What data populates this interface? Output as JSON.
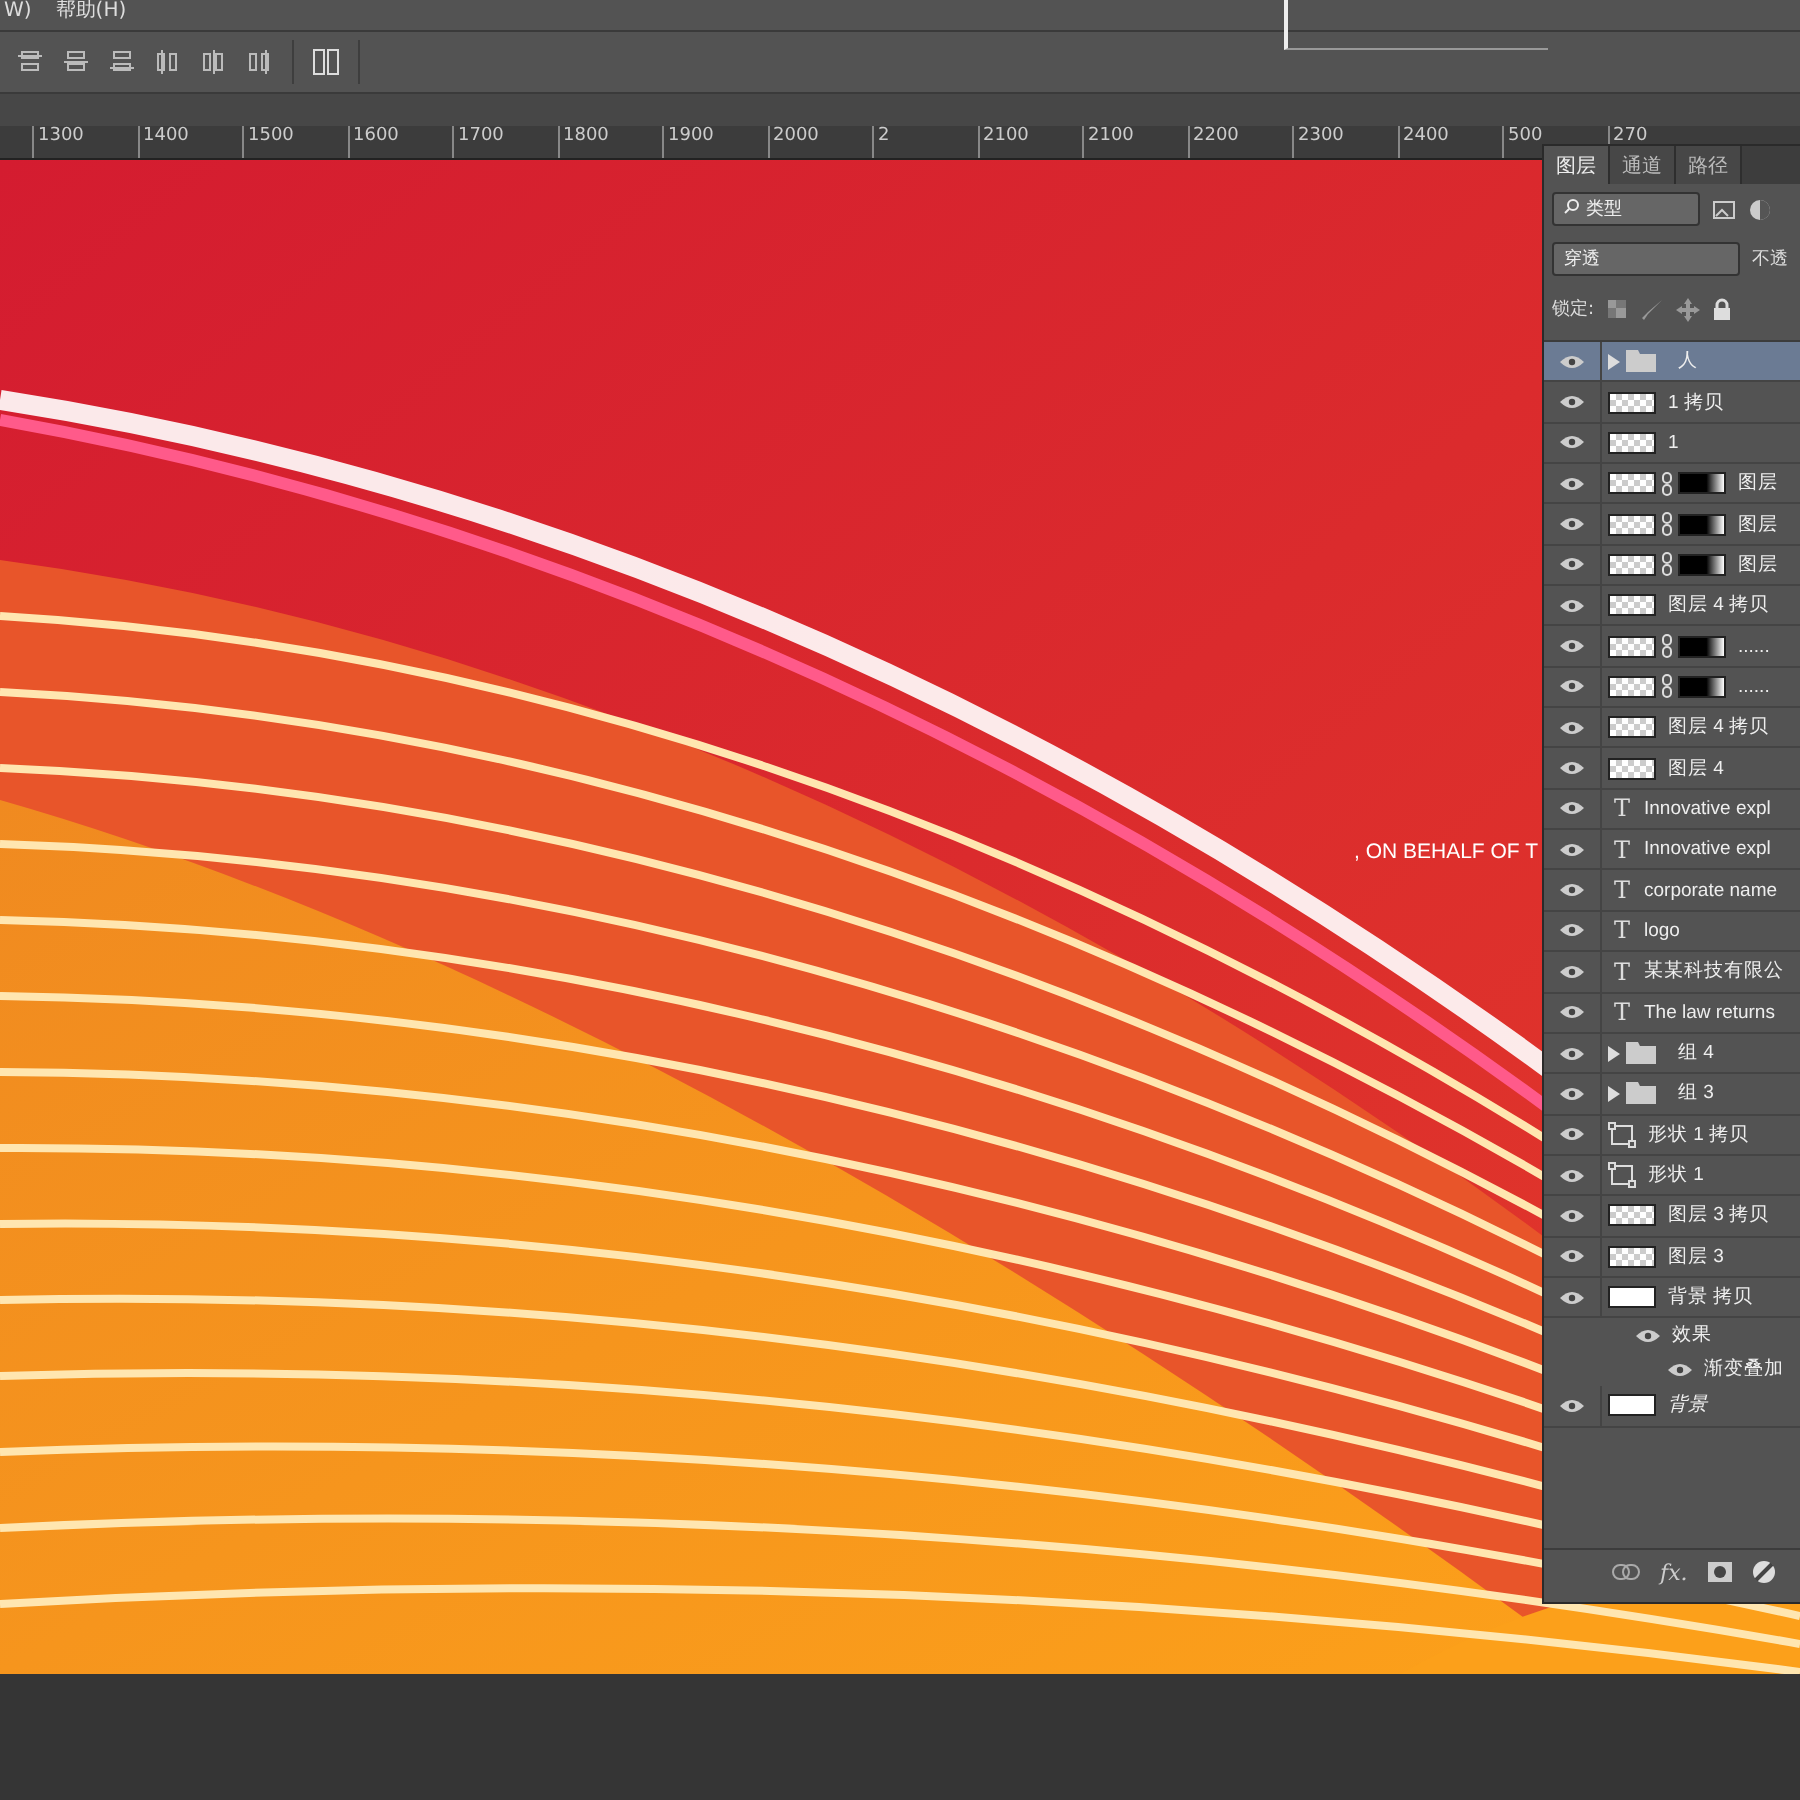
{
  "menu_bar": {
    "items": [
      "W)",
      "帮助(H)"
    ]
  },
  "ruler": {
    "labels": [
      "1300",
      "1400",
      "1500",
      "1600",
      "1700",
      "1800",
      "1900",
      "2000",
      "2",
      "2100",
      "2100",
      "2200",
      "2300",
      "2400",
      "500",
      "270"
    ]
  },
  "canvas": {
    "caption": ", ON BEHALF OF T"
  },
  "layers_panel": {
    "tabs": [
      {
        "label": "图层",
        "selected": true
      },
      {
        "label": "通道",
        "selected": false
      },
      {
        "label": "路径",
        "selected": false
      }
    ],
    "filter": "类型",
    "blend_mode": "穿透",
    "opacity_label": "不透",
    "lock_label": "锁定:",
    "layers": [
      {
        "kind": "group",
        "name": "人",
        "visible": true,
        "selected": true
      },
      {
        "kind": "pixel",
        "name": "1 拷贝",
        "visible": true,
        "selected": false
      },
      {
        "kind": "pixel",
        "name": "1",
        "visible": true,
        "selected": false
      },
      {
        "kind": "masked",
        "name": "图层",
        "visible": true,
        "selected": false
      },
      {
        "kind": "masked",
        "name": "图层",
        "visible": true,
        "selected": false
      },
      {
        "kind": "masked",
        "name": "图层",
        "visible": true,
        "selected": false
      },
      {
        "kind": "pixel",
        "name": "图层 4 拷贝",
        "visible": true,
        "selected": false
      },
      {
        "kind": "masked",
        "name": "......",
        "visible": true,
        "selected": false
      },
      {
        "kind": "masked",
        "name": "......",
        "visible": true,
        "selected": false
      },
      {
        "kind": "pixel",
        "name": "图层 4 拷贝",
        "visible": true,
        "selected": false
      },
      {
        "kind": "pixel",
        "name": "图层 4",
        "visible": true,
        "selected": false
      },
      {
        "kind": "text",
        "icon": "T",
        "name": "Innovative expl",
        "visible": true,
        "selected": false
      },
      {
        "kind": "text",
        "icon": "T",
        "name": "Innovative expl",
        "visible": true,
        "selected": false
      },
      {
        "kind": "text",
        "icon": "T",
        "name": "corporate name",
        "visible": true,
        "selected": false
      },
      {
        "kind": "text",
        "icon": "T",
        "name": "logo",
        "visible": true,
        "selected": false
      },
      {
        "kind": "text",
        "icon": "T",
        "name": "某某科技有限公",
        "visible": true,
        "selected": false
      },
      {
        "kind": "text",
        "icon": "T",
        "name": "The law returns",
        "visible": true,
        "selected": false
      },
      {
        "kind": "group",
        "name": "组 4",
        "visible": true,
        "selected": false
      },
      {
        "kind": "group",
        "name": "组 3",
        "visible": true,
        "selected": false
      },
      {
        "kind": "shape",
        "name": "形状 1 拷贝",
        "visible": true,
        "selected": false
      },
      {
        "kind": "shape",
        "name": "形状 1",
        "visible": true,
        "selected": false
      },
      {
        "kind": "pixel",
        "name": "图层 3 拷贝",
        "visible": true,
        "selected": false
      },
      {
        "kind": "pixel",
        "name": "图层 3",
        "visible": true,
        "selected": false
      },
      {
        "kind": "fill",
        "name": "背景 拷贝",
        "visible": true,
        "selected": false,
        "effects": {
          "label": "效果",
          "visible": true,
          "children": [
            {
              "label": "渐变叠加",
              "visible": true
            }
          ]
        }
      },
      {
        "kind": "background",
        "name": "背景",
        "visible": true,
        "selected": false
      }
    ],
    "footer": {
      "fx": "fx."
    }
  }
}
